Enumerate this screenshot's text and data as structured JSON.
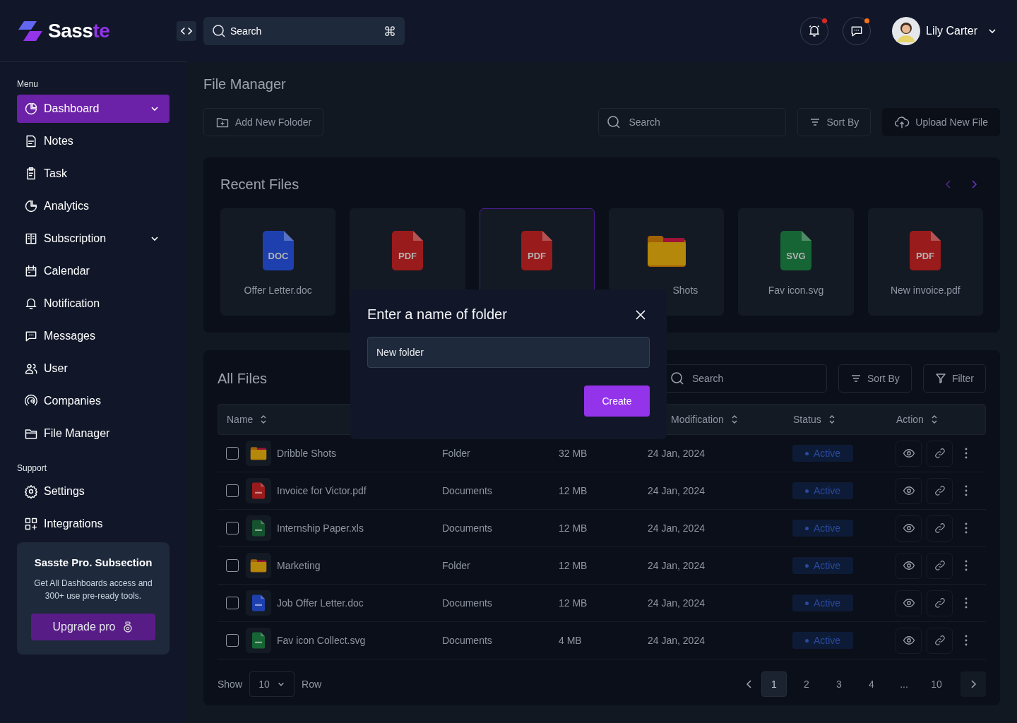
{
  "brand": {
    "name_main": "Sass",
    "name_accent": "te"
  },
  "header": {
    "search": {
      "placeholder": "Search",
      "shortcut": "⌘"
    },
    "alerts": [
      {
        "kind": "bell",
        "color": "#dc2626"
      },
      {
        "kind": "chat",
        "color": "#f97316"
      }
    ],
    "user": {
      "name": "Lily Carter"
    }
  },
  "sidebar": {
    "sections": [
      {
        "heading": "Menu",
        "items": [
          {
            "label": "Dashboard",
            "selected": true,
            "expandable": true
          },
          {
            "label": "Notes",
            "selected": false,
            "expandable": false
          },
          {
            "label": "Task",
            "selected": false,
            "expandable": false
          },
          {
            "label": "Analytics",
            "selected": false,
            "expandable": false
          },
          {
            "label": "Subscription",
            "selected": false,
            "expandable": true
          },
          {
            "label": "Calendar",
            "selected": false,
            "expandable": false
          },
          {
            "label": "Notification",
            "selected": false,
            "expandable": false
          },
          {
            "label": "Messages",
            "selected": false,
            "expandable": false
          },
          {
            "label": "User",
            "selected": false,
            "expandable": false
          },
          {
            "label": "Companies",
            "selected": false,
            "expandable": false
          },
          {
            "label": "File Manager",
            "selected": false,
            "expandable": false
          }
        ]
      },
      {
        "heading": "Support",
        "items": [
          {
            "label": "Settings",
            "selected": false,
            "expandable": false
          },
          {
            "label": "Integrations",
            "selected": false,
            "expandable": false
          }
        ]
      }
    ],
    "promo": {
      "title": "Sasste Pro. Subsection",
      "text": "Get All Dashboards access and 300+ use pre-ready tools.",
      "button": "Upgrade pro"
    }
  },
  "page": {
    "title": "File Manager",
    "add_folder": "Add New Foloder",
    "search": {
      "placeholder": "Search"
    },
    "sort": "Sort By",
    "upload": "Upload New File"
  },
  "recent": {
    "title": "Recent Files",
    "files": [
      {
        "kind": "doc",
        "badge": "DOC",
        "name": "Offer Letter.doc",
        "selected": false
      },
      {
        "kind": "pdf",
        "badge": "PDF",
        "selected": false
      },
      {
        "kind": "pdf",
        "badge": "PDF",
        "selected": true
      },
      {
        "kind": "folder",
        "name": "Shots",
        "name_covered_left": true,
        "selected": false
      },
      {
        "kind": "svg",
        "badge": "SVG",
        "name": "Fav icon.svg",
        "selected": false
      },
      {
        "kind": "pdf",
        "badge": "PDF",
        "name": "New invoice.pdf",
        "selected": false
      }
    ]
  },
  "all_files": {
    "title": "All Files",
    "search": {
      "placeholder": "Search"
    },
    "sort": "Sort By",
    "filter": "Filter",
    "columns": [
      "Name",
      "Modification",
      "Status",
      "Action"
    ],
    "rows": [
      {
        "kind": "folder",
        "name": "Dribble Shots",
        "type": "Folder",
        "size": "32 MB",
        "date": "24 Jan, 2024",
        "status": "Active",
        "checked": false
      },
      {
        "kind": "pdf",
        "name": "Invoice for Victor.pdf",
        "type": "Documents",
        "size": "12 MB",
        "date": "24 Jan, 2024",
        "status": "Active",
        "checked": false
      },
      {
        "kind": "xls",
        "name": "Internship Paper.xls",
        "type": "Documents",
        "size": "12 MB",
        "date": "24 Jan, 2024",
        "status": "Active",
        "checked": false
      },
      {
        "kind": "folder",
        "name": "Marketing",
        "type": "Folder",
        "size": "12 MB",
        "date": "24 Jan, 2024",
        "status": "Active",
        "checked": false
      },
      {
        "kind": "doc",
        "name": "Job Offer Letter.doc",
        "type": "Documents",
        "size": "12 MB",
        "date": "24 Jan, 2024",
        "status": "Active",
        "checked": false
      },
      {
        "kind": "svg",
        "name": "Fav icon Collect.svg",
        "type": "Documents",
        "size": "4 MB",
        "date": "24 Jan, 2024",
        "status": "Active",
        "checked": false
      }
    ],
    "footer": {
      "show": "Show",
      "rows_value": "10",
      "row": "Row",
      "pages": [
        {
          "label": "1",
          "selected": true
        },
        {
          "label": "2",
          "selected": false
        },
        {
          "label": "3",
          "selected": false
        },
        {
          "label": "4",
          "selected": false
        },
        {
          "label": "...",
          "selected": false
        },
        {
          "label": "10",
          "selected": false
        }
      ]
    }
  },
  "modal": {
    "title": "Enter a name of folder",
    "value": "New folder",
    "button": "Create"
  }
}
